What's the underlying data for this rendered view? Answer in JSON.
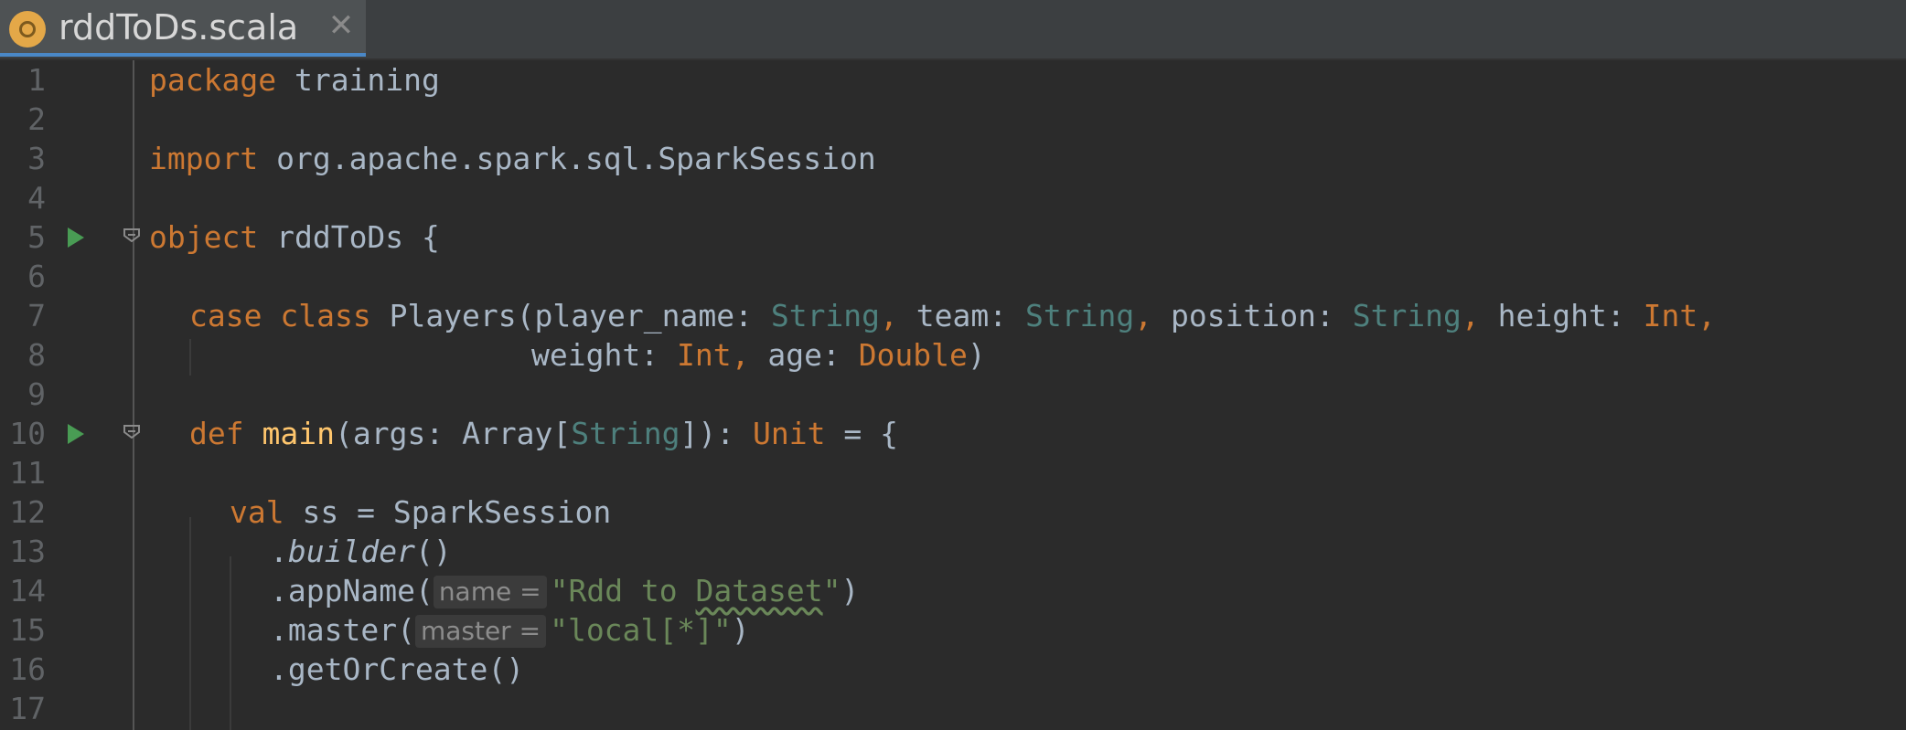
{
  "tab": {
    "title": "rddToDs.scala",
    "icon": "scala-object-icon",
    "close_icon": "close-icon"
  },
  "colors": {
    "background": "#2b2b2b",
    "keyword": "#cc7832",
    "type": "#4e807d",
    "string": "#6a8759",
    "function": "#ffc66d",
    "text": "#a9b7c6",
    "line_number": "#606366",
    "run": "#499c54"
  },
  "code": {
    "line_numbers": [
      "1",
      "2",
      "3",
      "4",
      "5",
      "6",
      "7",
      "8",
      "9",
      "10",
      "11",
      "12",
      "13",
      "14",
      "15",
      "16",
      "17"
    ],
    "l1": {
      "kw": "package",
      "name": "training"
    },
    "l3": {
      "kw": "import",
      "path": "org.apache.spark.sql.SparkSession"
    },
    "l5": {
      "kw": "object",
      "name": "rddToDs",
      "brace": "{"
    },
    "l7": {
      "kw1": "case",
      "kw2": "class",
      "name": "Players(",
      "p1": "player_name",
      "p2": "team",
      "p3": "position",
      "p4": "height",
      "t_string": "String",
      "t_int": "Int",
      "colon": ":",
      "comma": ","
    },
    "l8": {
      "p5": "weight",
      "p6": "age",
      "t_int": "Int",
      "t_double": "Double",
      "close": ")"
    },
    "l10": {
      "kw": "def",
      "fn": "main",
      "open": "(",
      "arg": "args",
      "colon": ":",
      "array": "Array[",
      "t_string": "String",
      "close": "])",
      "ret": "Unit",
      "rest": " = {"
    },
    "l12": {
      "kw": "val",
      "rest": "ss = SparkSession"
    },
    "l13": {
      "dot": ".",
      "method": "builder",
      "parens": "()"
    },
    "l14": {
      "method": ".appName(",
      "hint": "name",
      "eq": "=",
      "q1": "\"Rdd to ",
      "q2": "Dataset",
      "q3": "\"",
      "close": ")"
    },
    "l15": {
      "method": ".master(",
      "hint": "master",
      "eq": "=",
      "str": "\"local[*]\"",
      "close": ")"
    },
    "l16": {
      "method": ".getOrCreate()"
    }
  }
}
